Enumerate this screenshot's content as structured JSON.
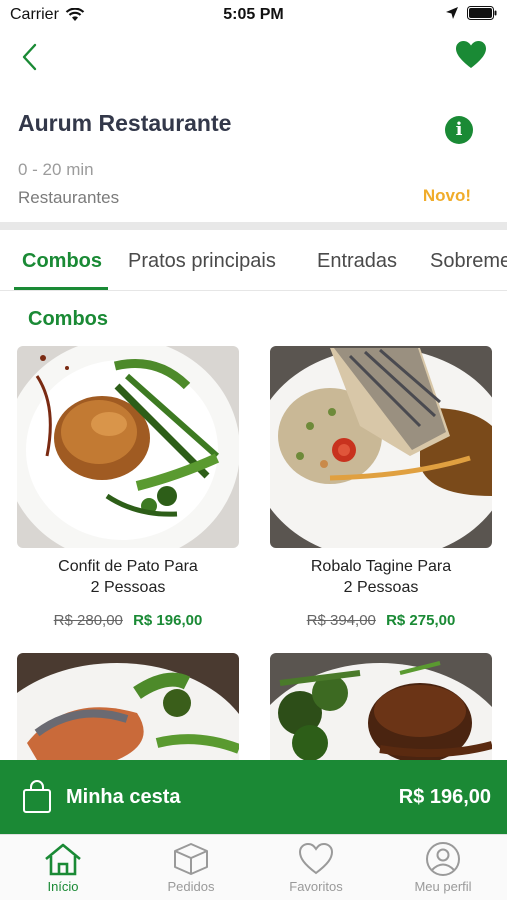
{
  "status_bar": {
    "carrier": "Carrier",
    "time": "5:05 PM"
  },
  "restaurant": {
    "name": "Aurum Restaurante",
    "delivery_time": "0 - 20 min",
    "category": "Restaurantes",
    "badge": "Novo!"
  },
  "tabs": [
    {
      "label": "Combos"
    },
    {
      "label": "Pratos principais"
    },
    {
      "label": "Entradas"
    },
    {
      "label": "Sobremesas"
    }
  ],
  "section": {
    "title": "Combos"
  },
  "products": [
    {
      "name_line1": "Confit de Pato Para",
      "name_line2": "2 Pessoas",
      "old_price": "R$ 280,00",
      "price": "R$ 196,00"
    },
    {
      "name_line1": "Robalo Tagine Para",
      "name_line2": "2 Pessoas",
      "old_price": "R$ 394,00",
      "price": "R$ 275,00"
    }
  ],
  "cart": {
    "label": "Minha cesta",
    "total": "R$ 196,00"
  },
  "bottom_nav": [
    {
      "label": "Início",
      "icon": "home-icon"
    },
    {
      "label": "Pedidos",
      "icon": "box-icon"
    },
    {
      "label": "Favoritos",
      "icon": "heart-icon"
    },
    {
      "label": "Meu perfil",
      "icon": "user-icon"
    }
  ],
  "colors": {
    "primary": "#1a8a35",
    "accent": "#f0ac2a"
  }
}
